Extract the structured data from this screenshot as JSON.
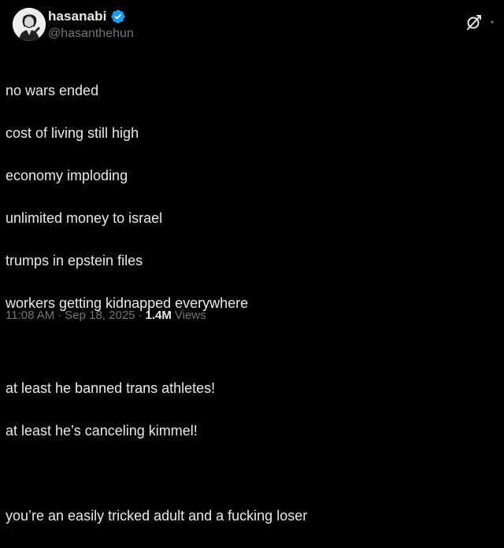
{
  "author": {
    "display_name": "hasanabi",
    "handle": "@hasanthehun",
    "verified": true,
    "avatar_icon": "profile-photo",
    "verified_icon": "verified-badge-icon",
    "verified_color": "#1d9bf0"
  },
  "actions": {
    "grok_icon": "grok-icon",
    "more_icon": "more-options-icon"
  },
  "tweet": {
    "lines": [
      "no wars ended",
      "cost of living still high",
      "economy imploding",
      "unlimited money to israel",
      "trumps in epstein files",
      "workers getting kidnapped everywhere",
      "",
      "at least he banned trans athletes!",
      "at least he’s canceling kimmel!",
      "",
      "you’re an easily tricked adult and a fucking loser"
    ]
  },
  "meta": {
    "time": "11:08 AM",
    "separator": "·",
    "date": "Sep 18, 2025",
    "views_count": "1.4M",
    "views_label": "Views"
  },
  "colors": {
    "background": "#000000",
    "text_primary": "#e7e9ea",
    "text_secondary": "#71767b"
  }
}
